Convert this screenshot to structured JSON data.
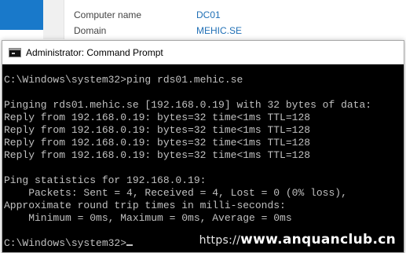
{
  "background_window": {
    "rows": [
      {
        "key": "Computer name",
        "value": "DC01"
      },
      {
        "key": "Domain",
        "value": "MEHIC.SE"
      }
    ]
  },
  "cmd": {
    "title": "Administrator: Command Prompt",
    "icon": "cmd-icon",
    "lines": [
      "C:\\Windows\\system32>ping rds01.mehic.se",
      "",
      "Pinging rds01.mehic.se [192.168.0.19] with 32 bytes of data:",
      "Reply from 192.168.0.19: bytes=32 time<1ms TTL=128",
      "Reply from 192.168.0.19: bytes=32 time<1ms TTL=128",
      "Reply from 192.168.0.19: bytes=32 time<1ms TTL=128",
      "Reply from 192.168.0.19: bytes=32 time<1ms TTL=128",
      "",
      "Ping statistics for 192.168.0.19:",
      "    Packets: Sent = 4, Received = 4, Lost = 0 (0% loss),",
      "Approximate round trip times in milli-seconds:",
      "    Minimum = 0ms, Maximum = 0ms, Average = 0ms",
      "",
      "C:\\Windows\\system32>"
    ]
  },
  "watermark": {
    "prefix": "https://",
    "text": "www.anquanclub.cn"
  },
  "colors": {
    "console_bg": "#000000",
    "console_fg": "#c0c0c0",
    "accent_blue": "#1979ca",
    "link_blue": "#1f6fb5"
  }
}
